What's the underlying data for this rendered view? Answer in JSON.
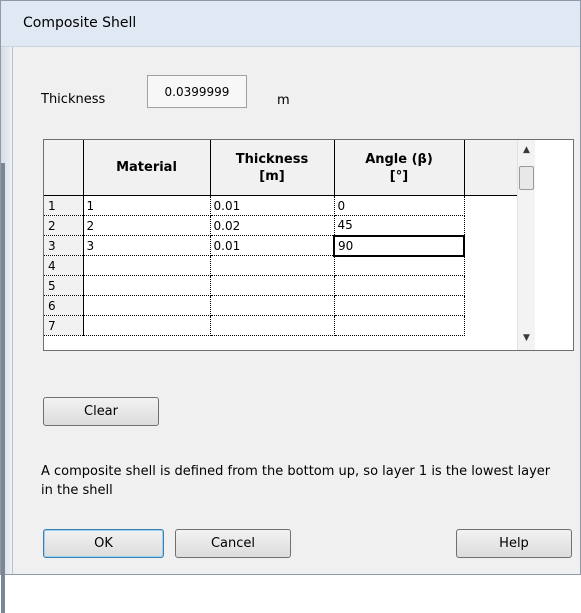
{
  "window": {
    "title": "Composite Shell"
  },
  "thickness": {
    "label": "Thickness",
    "value": "0.0399999",
    "unit": "m"
  },
  "table": {
    "headers": [
      "",
      "Material",
      "Thickness\n[m]",
      "Angle (β)\n[°]"
    ],
    "rows": [
      {
        "num": "1",
        "material": "1",
        "thickness": "0.01",
        "angle": "0"
      },
      {
        "num": "2",
        "material": "2",
        "thickness": "0.02",
        "angle": "45"
      },
      {
        "num": "3",
        "material": "3",
        "thickness": "0.01",
        "angle": "90"
      },
      {
        "num": "4",
        "material": "",
        "thickness": "",
        "angle": ""
      },
      {
        "num": "5",
        "material": "",
        "thickness": "",
        "angle": ""
      },
      {
        "num": "6",
        "material": "",
        "thickness": "",
        "angle": ""
      },
      {
        "num": "7",
        "material": "",
        "thickness": "",
        "angle": ""
      }
    ]
  },
  "buttons": {
    "clear": "Clear",
    "ok": "OK",
    "cancel": "Cancel",
    "help": "Help"
  },
  "message": "A composite shell is defined from the bottom up, so layer 1 is the lowest layer in the shell",
  "colors": {
    "titlebar": "#dfe8f3",
    "dialog_bg": "#f0f0f0",
    "default_button_border": "#3c7fb1"
  }
}
